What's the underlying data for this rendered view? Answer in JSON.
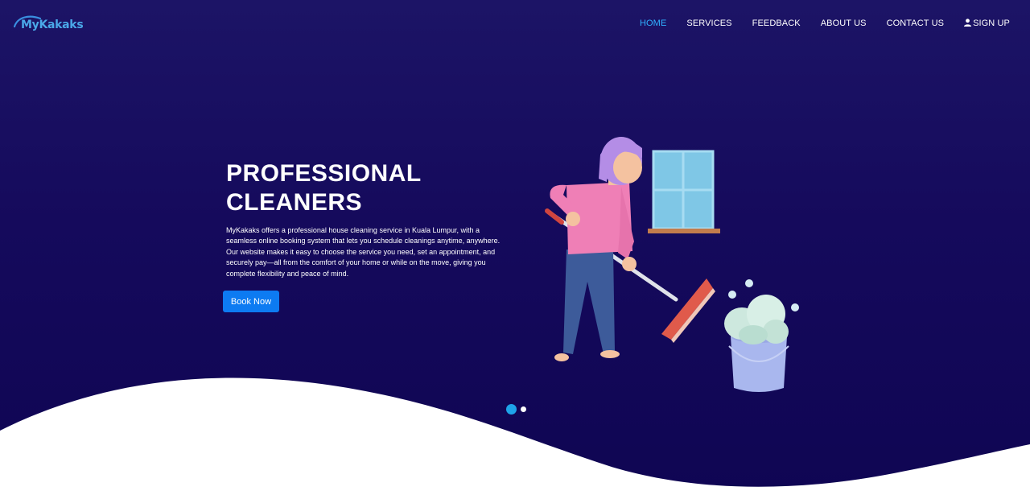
{
  "brand": {
    "name": "MyKakaks"
  },
  "nav": {
    "items": [
      {
        "label": "HOME",
        "active": true
      },
      {
        "label": "SERVICES",
        "active": false
      },
      {
        "label": "FEEDBACK",
        "active": false
      },
      {
        "label": "ABOUT US",
        "active": false
      },
      {
        "label": "CONTACT US",
        "active": false
      }
    ],
    "signup_label": "SIGN UP",
    "signup_icon": "user-icon"
  },
  "hero": {
    "title_line1": "PROFESSIONAL",
    "title_line2": "CLEANERS",
    "description": "MyKakaks offers a professional house cleaning service in Kuala Lumpur, with a seamless online booking system that lets you schedule cleanings anytime, anywhere. Our website makes it easy to choose the service you need, set an appointment, and securely pay—all from the comfort of your home or while on the move, giving you complete flexibility and peace of mind.",
    "cta_label": "Book Now"
  },
  "carousel": {
    "slides": 2,
    "active_index": 0
  },
  "colors": {
    "background": "#150a5c",
    "nav_active": "#2fb0ff",
    "button": "#0d7bf2",
    "dot_active": "#1ea3e9"
  }
}
